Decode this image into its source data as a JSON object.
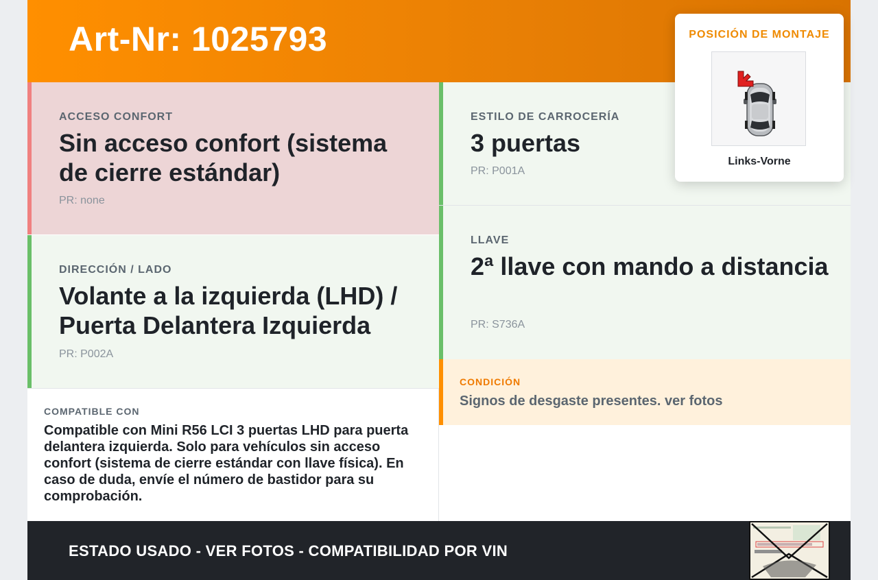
{
  "header": {
    "art_nr": "Art-Nr: 1025793"
  },
  "cards": {
    "acceso_confort": {
      "label": "ACCESO CONFORT",
      "value": "Sin acceso confort (sistema de cierre estándar)",
      "pr": "PR: none"
    },
    "direccion_lado": {
      "label": "DIRECCIÓN / LADO",
      "value": "Volante a la izquierda (LHD) / Puerta Delantera Izquierda",
      "pr": "PR: P002A"
    },
    "estilo_carroceria": {
      "label": "ESTILO DE CARROCERÍA",
      "value": "3 puertas",
      "pr": "PR: P001A"
    },
    "llave": {
      "label": "LLAVE",
      "value": "2ª llave con mando a distancia",
      "pr": "PR: S736A"
    }
  },
  "compatible": {
    "label": "COMPATIBLE CON",
    "text": "Compatible con Mini R56 LCI 3 puertas LHD para puerta delantera izquierda. Solo para vehículos sin acceso confort (sistema de cierre estándar con llave física). En caso de duda, envíe el número de bastidor para su comprobación."
  },
  "condicion": {
    "label": "CONDICIÓN",
    "text": "Signos de desgaste presentes. ver fotos"
  },
  "footer": {
    "text": "ESTADO USADO - VER FOTOS - COMPATIBILIDAD POR VIN"
  },
  "mount": {
    "title": "POSICIÓN DE MONTAJE",
    "caption": "Links-Vorne"
  },
  "colors": {
    "accent": "#ff8f00",
    "green": "#6abf69",
    "red": "#f08080",
    "dark": "#212429"
  }
}
